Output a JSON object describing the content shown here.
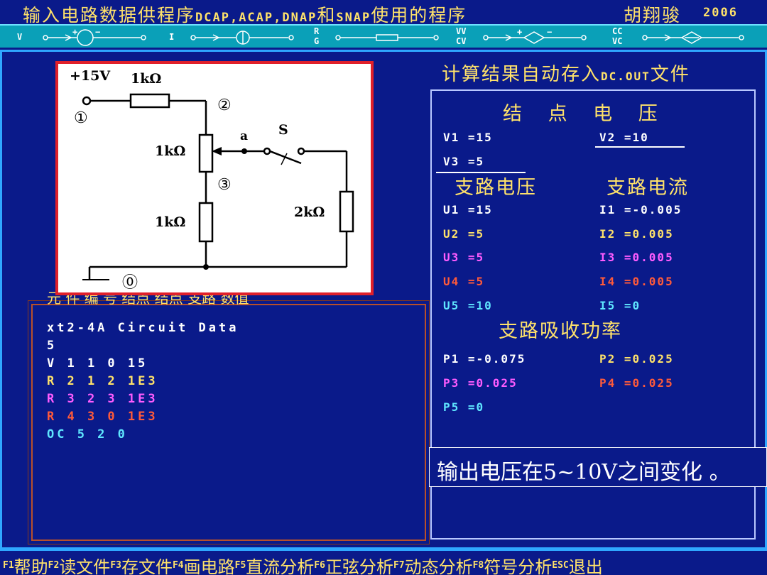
{
  "title": {
    "part1": "输入电路数据供程序",
    "part2": "DCAP,ACAP,DNAP",
    "part3": "和",
    "part4": "SNAP",
    "part5": "使用的程序",
    "author": "胡翔骏",
    "year": "2006"
  },
  "components": {
    "v_label": "V",
    "i_label": "I",
    "r_label": "R",
    "g_label": "G",
    "vv_label": "VV",
    "cv_label": "CV",
    "cc_label": "CC",
    "vc_label": "VC"
  },
  "circuit": {
    "source": "+15V",
    "r1": "1kΩ",
    "r2": "1kΩ",
    "r3": "1kΩ",
    "r4": "2kΩ",
    "node1": "①",
    "node2": "②",
    "node3": "③",
    "node0": "⓪",
    "tap": "a",
    "switch": "S"
  },
  "obscured_row": "元  件  编  号  结点  结点  支路  数值",
  "data_file": {
    "lines": [
      {
        "text": "xt2-4A Circuit Data",
        "color": "#ffffff"
      },
      {
        "text": "5",
        "color": "#ffffff"
      },
      {
        "text": "V 1 1 0 15",
        "color": "#ffffff"
      },
      {
        "text": "R 2 1 2 1E3",
        "color": "#ffe26a"
      },
      {
        "text": "R 3 2 3 1E3",
        "color": "#ff5cff"
      },
      {
        "text": "R 4 3 0 1E3",
        "color": "#ff5a3a"
      },
      {
        "text": "OC 5 2 0",
        "color": "#5fe6ff"
      }
    ]
  },
  "results": {
    "title_cn": "计算结果自动存入",
    "title_file": "DC.OUT",
    "title_end": "文件",
    "node_voltage_head": "结 点 电 压",
    "node_voltages": {
      "v1": "V1 =15",
      "v2": "V2 =10",
      "v3": "V3 =5"
    },
    "branch_voltage_head": "支路电压",
    "branch_current_head": "支路电流",
    "branch_voltages": [
      "U1 =15",
      "U2 =5",
      "U3 =5",
      "U4 =5",
      "U5 =10"
    ],
    "branch_currents": [
      "I1 =-0.005",
      "I2 =0.005",
      "I3 =0.005",
      "I4 =0.005",
      "I5 =0"
    ],
    "power_head": "支路吸收功率",
    "powers": [
      "P1 =-0.075",
      "P2 =0.025",
      "P3 =0.025",
      "P4 =0.025",
      "P5 =0"
    ],
    "colors": {
      "white": "#ffffff",
      "yellow": "#ffe26a",
      "magenta": "#ff5cff",
      "red": "#ff5a3a",
      "cyan": "#5fe6ff"
    }
  },
  "note": "输出电压在5~10V之间变化 。",
  "fkeys": [
    {
      "key": "F1",
      "label": "帮助"
    },
    {
      "key": "F2",
      "label": "读文件"
    },
    {
      "key": "F3",
      "label": "存文件"
    },
    {
      "key": "F4",
      "label": "画电路"
    },
    {
      "key": "F5",
      "label": "直流分析"
    },
    {
      "key": "F6",
      "label": "正弦分析"
    },
    {
      "key": "F7",
      "label": "动态分析"
    },
    {
      "key": "F8",
      "label": "符号分析"
    },
    {
      "key": "ESC",
      "label": "退出"
    }
  ]
}
